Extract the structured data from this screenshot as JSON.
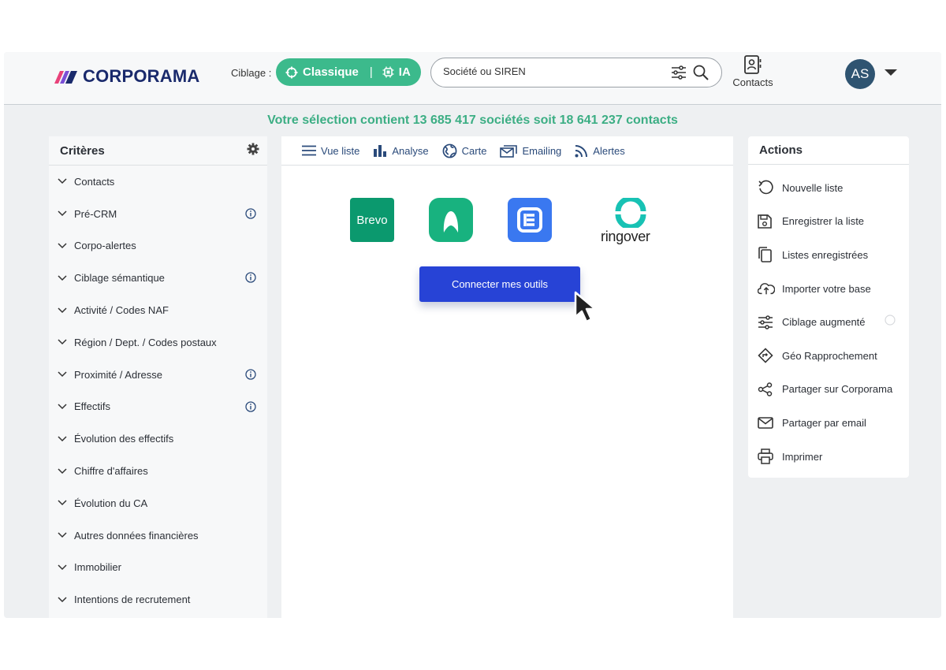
{
  "header": {
    "logo_text": "CORPORAMA",
    "ciblage_label": "Ciblage :",
    "ciblage_classique": "Classique",
    "ciblage_ia": "IA",
    "search_placeholder": "Société ou SIREN",
    "contacts_label": "Contacts",
    "avatar_initials": "AS"
  },
  "banner": "Votre sélection contient 13 685 417 sociétés soit 18 641 237 contacts",
  "criteria": {
    "title": "Critères",
    "items": [
      {
        "label": "Contacts",
        "info": false
      },
      {
        "label": "Pré-CRM",
        "info": true
      },
      {
        "label": "Corpo-alertes",
        "info": false
      },
      {
        "label": "Ciblage sémantique",
        "info": true
      },
      {
        "label": "Activité / Codes NAF",
        "info": false
      },
      {
        "label": "Région / Dept. / Codes postaux",
        "info": false
      },
      {
        "label": "Proximité / Adresse",
        "info": true
      },
      {
        "label": "Effectifs",
        "info": true
      },
      {
        "label": "Évolution des effectifs",
        "info": false
      },
      {
        "label": "Chiffre d'affaires",
        "info": false
      },
      {
        "label": "Évolution du CA",
        "info": false
      },
      {
        "label": "Autres données financières",
        "info": false
      },
      {
        "label": "Immobilier",
        "info": false
      },
      {
        "label": "Intentions de recrutement",
        "info": false
      }
    ]
  },
  "tabs": [
    {
      "label": "Vue liste",
      "icon": "list-icon"
    },
    {
      "label": "Analyse",
      "icon": "bar-chart-icon"
    },
    {
      "label": "Carte",
      "icon": "globe-icon"
    },
    {
      "label": "Emailing",
      "icon": "mail-stack-icon"
    },
    {
      "label": "Alertes",
      "icon": "rss-icon"
    }
  ],
  "integrations": {
    "brevo": "Brevo",
    "ringover": "ringover",
    "connect_button": "Connecter mes outils"
  },
  "actions": {
    "title": "Actions",
    "items": [
      {
        "label": "Nouvelle liste",
        "icon": "undo-icon"
      },
      {
        "label": "Enregistrer la liste",
        "icon": "save-icon"
      },
      {
        "label": "Listes enregistrées",
        "icon": "copy-icon"
      },
      {
        "label": "Importer votre base",
        "icon": "cloud-upload-icon"
      },
      {
        "label": "Ciblage augmenté",
        "icon": "sliders-icon"
      },
      {
        "label": "Géo Rapprochement",
        "icon": "direction-icon"
      },
      {
        "label": "Partager sur Corporama",
        "icon": "share-icon"
      },
      {
        "label": "Partager par email",
        "icon": "envelope-icon"
      },
      {
        "label": "Imprimer",
        "icon": "printer-icon"
      }
    ]
  },
  "colors": {
    "accent_green": "#3cba8c",
    "banner_green": "#3cae84",
    "connect_blue": "#2743d6",
    "avatar_bg": "#2f5471"
  }
}
